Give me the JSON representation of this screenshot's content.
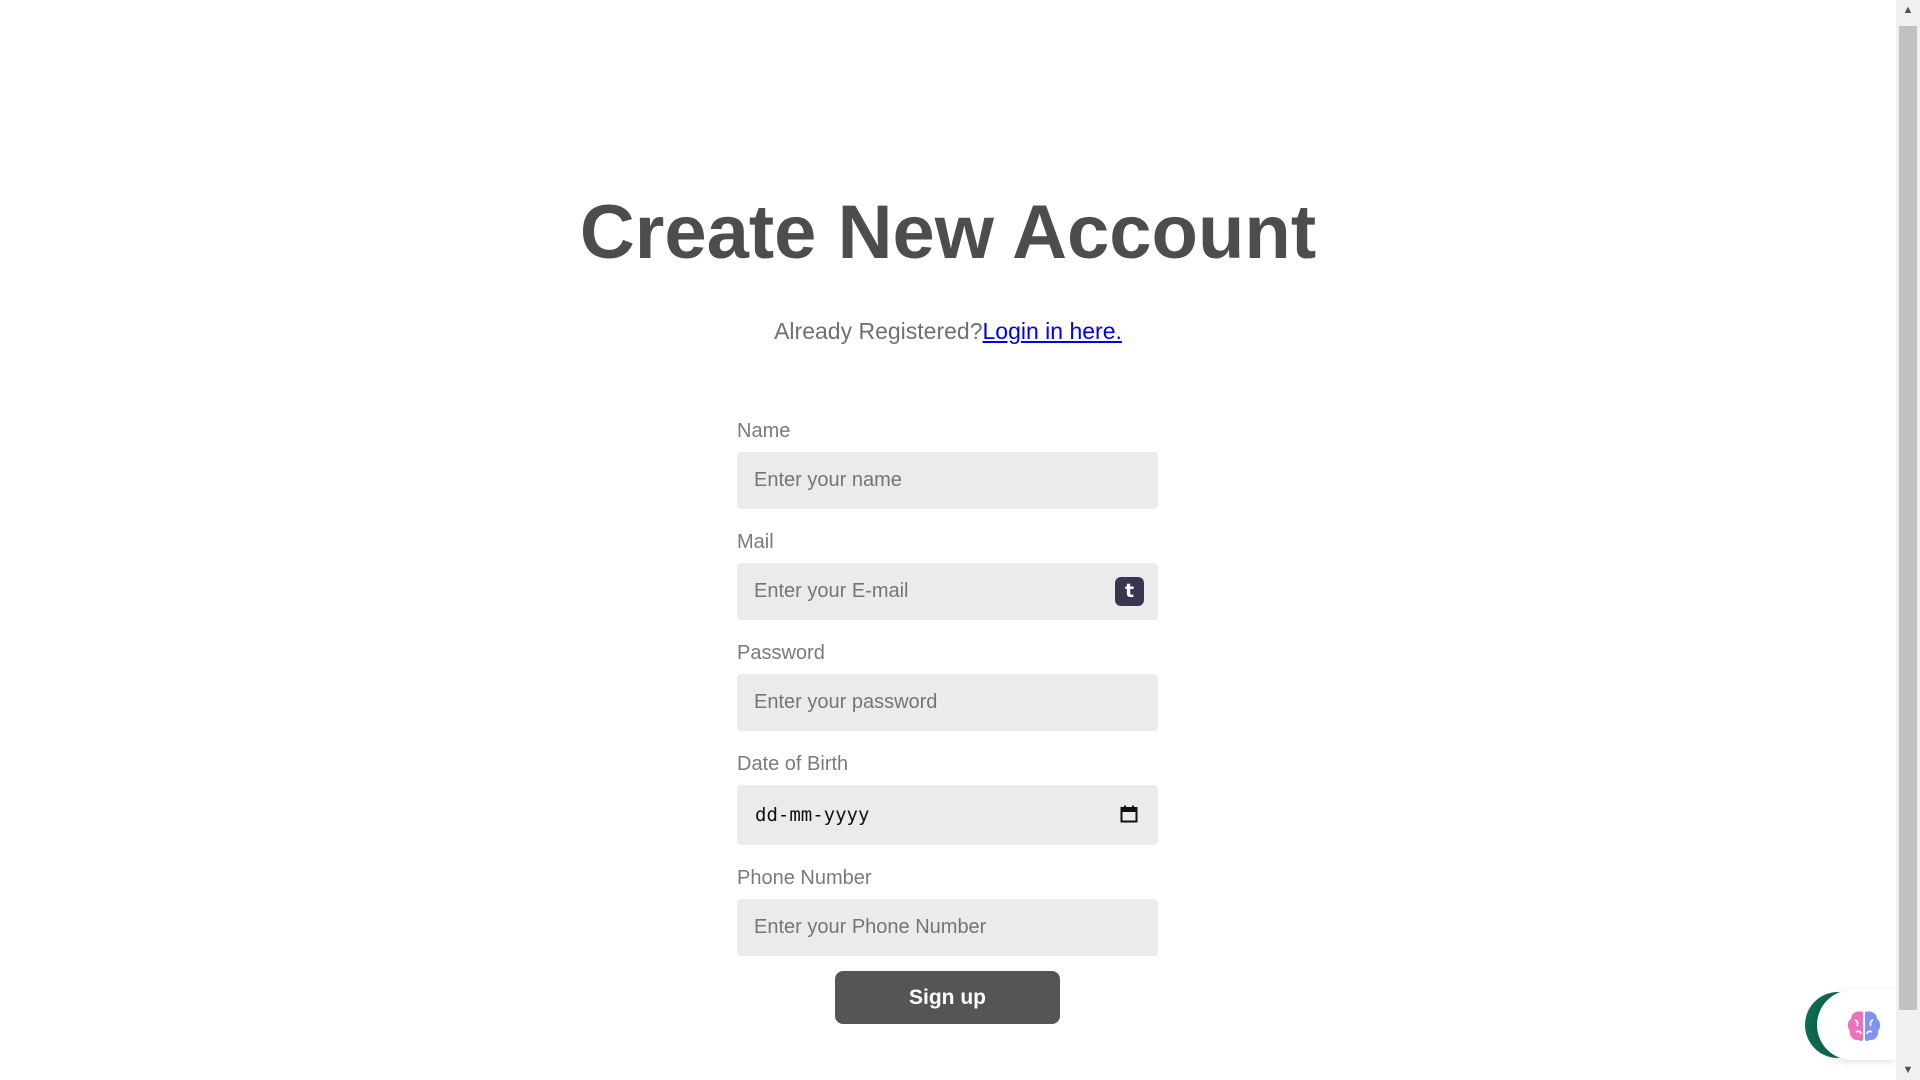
{
  "header": {
    "title": "Create New Account",
    "already_registered": "Already Registered?",
    "login_link": "Login in here."
  },
  "form": {
    "name": {
      "label": "Name",
      "placeholder": "Enter your name"
    },
    "mail": {
      "label": "Mail",
      "placeholder": "Enter your E-mail",
      "extension_badge": "t"
    },
    "password": {
      "label": "Password",
      "placeholder": "Enter your password"
    },
    "dob": {
      "label": "Date of Birth",
      "placeholder": "dd-mm-yyyy",
      "icon": "calendar-icon"
    },
    "phone": {
      "label": "Phone Number",
      "placeholder": "Enter your Phone Number"
    },
    "submit_label": "Sign up"
  },
  "widget": {
    "icon": "brain-icon",
    "colors": {
      "green": "#0e6a52",
      "brain_pink": "#e85ab0",
      "brain_blue": "#6a7ff0"
    }
  },
  "colors": {
    "title": "#4d4d4d",
    "link": "#0000ee",
    "input_bg": "#ebebeb",
    "button_bg": "#555555"
  }
}
